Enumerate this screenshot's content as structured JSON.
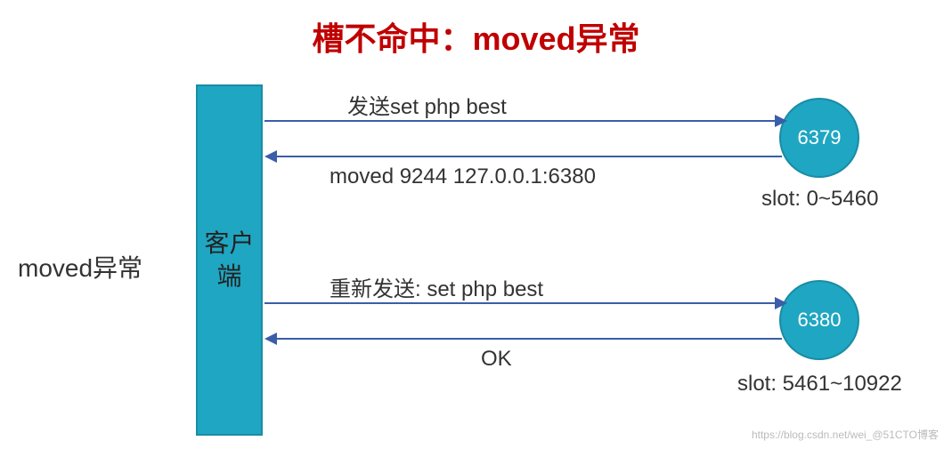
{
  "title": "槽不命中：moved异常",
  "leftLabel": "moved异常",
  "client": {
    "label": "客户\n端"
  },
  "nodes": {
    "n1": {
      "port": "6379",
      "slot": "slot: 0~5460"
    },
    "n2": {
      "port": "6380",
      "slot": "slot: 5461~10922"
    }
  },
  "arrows": {
    "a1": "发送set php best",
    "a2": "moved 9244 127.0.0.1:6380",
    "a3": "重新发送: set php best",
    "a4": "OK"
  },
  "watermark": "https://blog.csdn.net/wei_@51CTO博客"
}
